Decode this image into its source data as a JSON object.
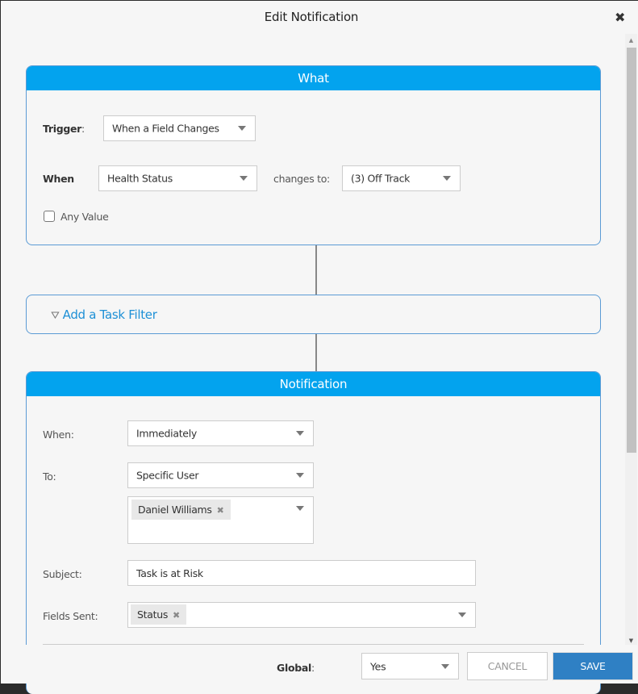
{
  "dialog": {
    "title": "Edit Notification",
    "close_icon": "close-icon"
  },
  "what_panel": {
    "header": "What",
    "trigger_label": "Trigger",
    "trigger_colon": ":",
    "trigger_value": "When a Field Changes",
    "when_label": "When",
    "field_value": "Health Status",
    "changes_to_label": "changes to:",
    "changes_to_value": "(3) Off Track",
    "any_value_label": "Any Value",
    "any_value_checked": false
  },
  "filter": {
    "icon": "filter-icon",
    "label": "Add a Task Filter"
  },
  "notification_panel": {
    "header": "Notification",
    "when_label": "When:",
    "when_value": "Immediately",
    "to_label": "To:",
    "to_value": "Specific User",
    "recipients": [
      "Daniel Williams"
    ],
    "subject_label": "Subject:",
    "subject_value": "Task is at Risk",
    "fields_sent_label": "Fields Sent:",
    "fields_sent": [
      "Status"
    ]
  },
  "footer": {
    "global_label": "Global",
    "global_colon": ":",
    "global_value": "Yes",
    "cancel_label": "CANCEL",
    "save_label": "SAVE"
  },
  "colors": {
    "header_blue": "#03a3ee",
    "save_blue": "#2f80c4",
    "link_blue": "#1e90d6",
    "panel_border": "#5b9bd5"
  }
}
